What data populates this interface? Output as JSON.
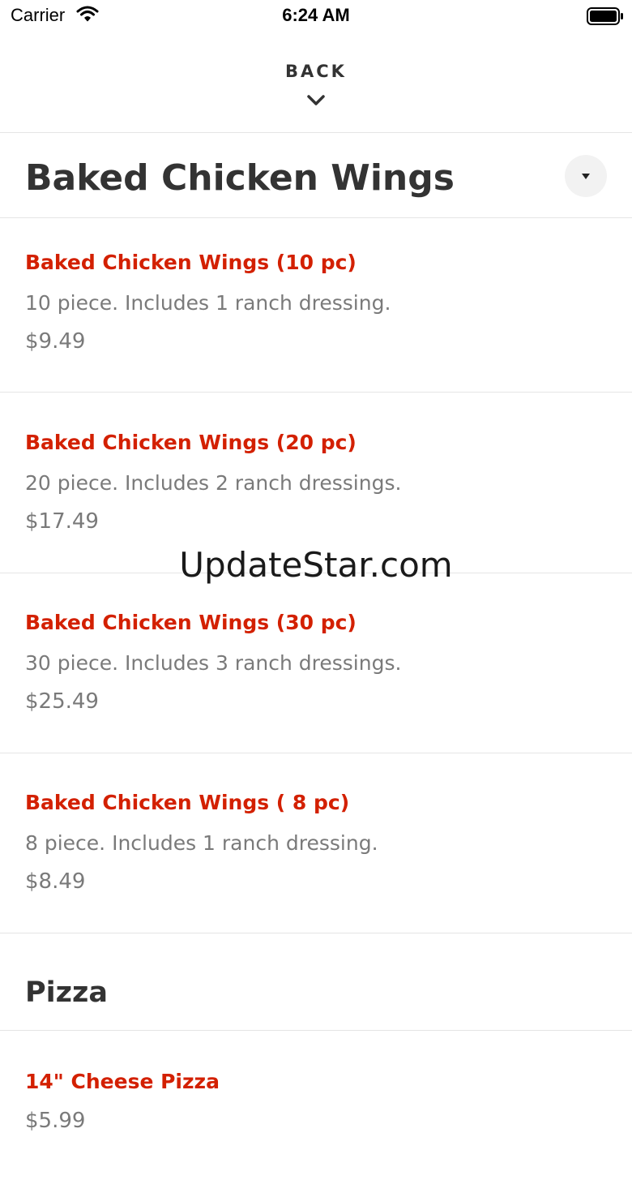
{
  "status_bar": {
    "carrier": "Carrier",
    "time": "6:24 AM"
  },
  "header": {
    "back_label": "BACK"
  },
  "sections": [
    {
      "title": "Baked Chicken Wings",
      "items": [
        {
          "name": "Baked Chicken Wings (10 pc)",
          "description": "10 piece. Includes 1 ranch dressing.",
          "price": "$9.49"
        },
        {
          "name": "Baked Chicken Wings (20 pc)",
          "description": "20 piece. Includes 2 ranch dressings.",
          "price": "$17.49"
        },
        {
          "name": "Baked Chicken Wings (30 pc)",
          "description": "30 piece. Includes 3 ranch dressings.",
          "price": "$25.49"
        },
        {
          "name": "Baked Chicken Wings ( 8 pc)",
          "description": "8 piece. Includes 1 ranch dressing.",
          "price": "$8.49"
        }
      ]
    },
    {
      "title": "Pizza",
      "items": [
        {
          "name": "14\" Cheese Pizza",
          "price": "$5.99"
        }
      ]
    }
  ],
  "watermark": "UpdateStar.com",
  "colors": {
    "item_name": "#d32000",
    "text_secondary": "#7a7a7a",
    "divider": "#e5e5e5"
  }
}
